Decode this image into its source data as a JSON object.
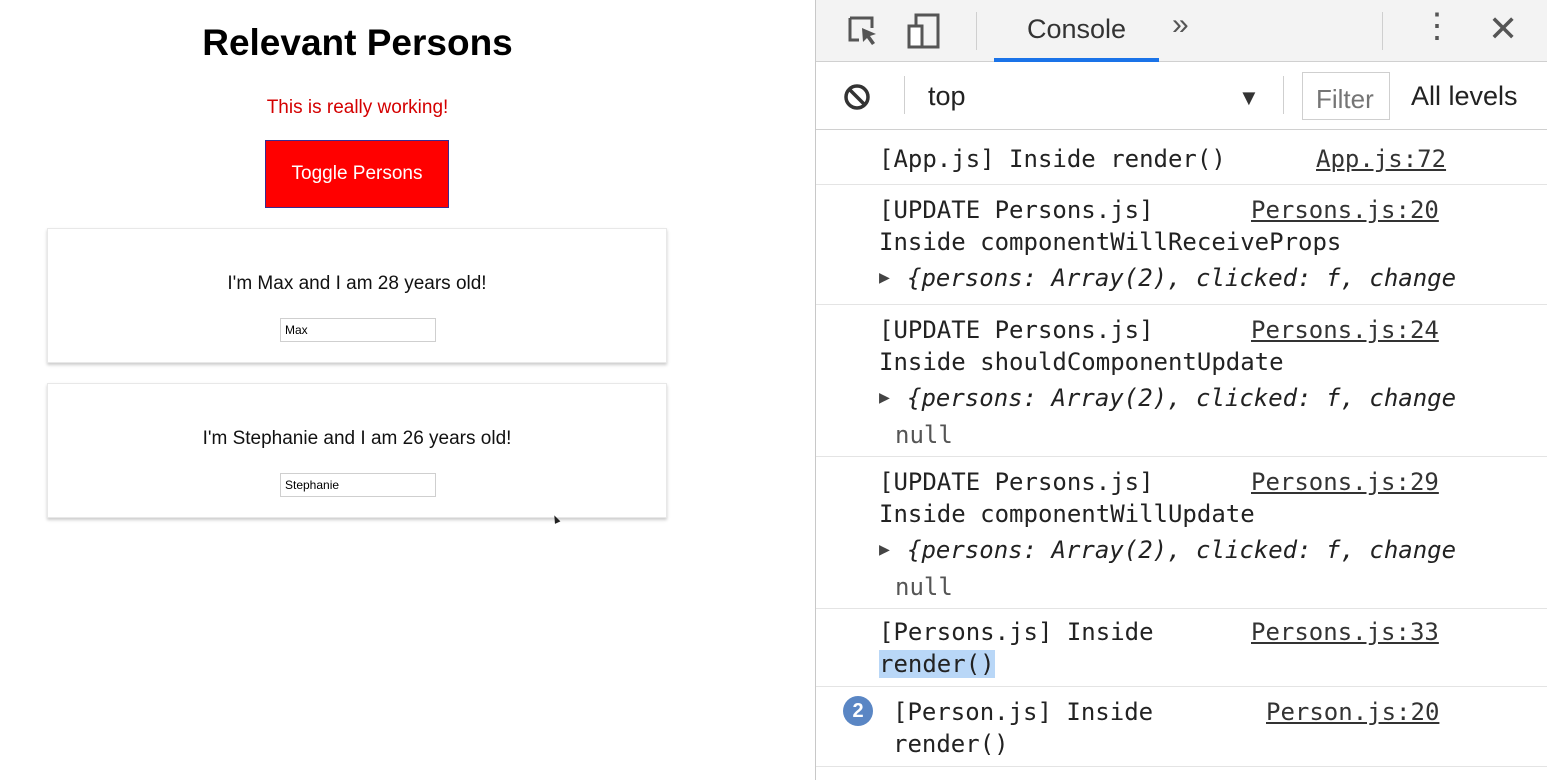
{
  "app": {
    "title": "Relevant Persons",
    "status": "This is really working!",
    "toggle_label": "Toggle Persons",
    "persons": [
      {
        "text": "I'm Max and I am 28 years old!",
        "value": "Max"
      },
      {
        "text": "I'm Stephanie and I am 26 years old!",
        "value": "Stephanie"
      }
    ],
    "colors": {
      "status": "#d40000",
      "button": "#ff0000"
    }
  },
  "devtools": {
    "toolbar": {
      "tab": "Console",
      "more": "»",
      "kebab": "⋮",
      "close": "✕"
    },
    "filterbar": {
      "context": "top",
      "dropdown": "▼",
      "filter_placeholder": "Filter",
      "levels": "All levels"
    },
    "logs": [
      {
        "lines": [
          "[App.js] Inside render()"
        ],
        "source": "App.js:72"
      },
      {
        "lines": [
          "[UPDATE Persons.js]",
          "Inside componentWillReceiveProps"
        ],
        "source": "Persons.js:20",
        "object": "{persons: Array(2), clicked: f, change"
      },
      {
        "lines": [
          "[UPDATE Persons.js]",
          "Inside shouldComponentUpdate"
        ],
        "source": "Persons.js:24",
        "object": "{persons: Array(2), clicked: f, change",
        "extra": "null"
      },
      {
        "lines": [
          "[UPDATE Persons.js]",
          "Inside componentWillUpdate"
        ],
        "source": "Persons.js:29",
        "object": "{persons: Array(2), clicked: f, change",
        "extra": "null"
      },
      {
        "lines": [
          "[Persons.js] Inside",
          "render()"
        ],
        "source": "Persons.js:33"
      },
      {
        "lines": [
          "[Person.js] Inside",
          "render()"
        ],
        "source": "Person.js:20",
        "count": "2"
      }
    ]
  }
}
